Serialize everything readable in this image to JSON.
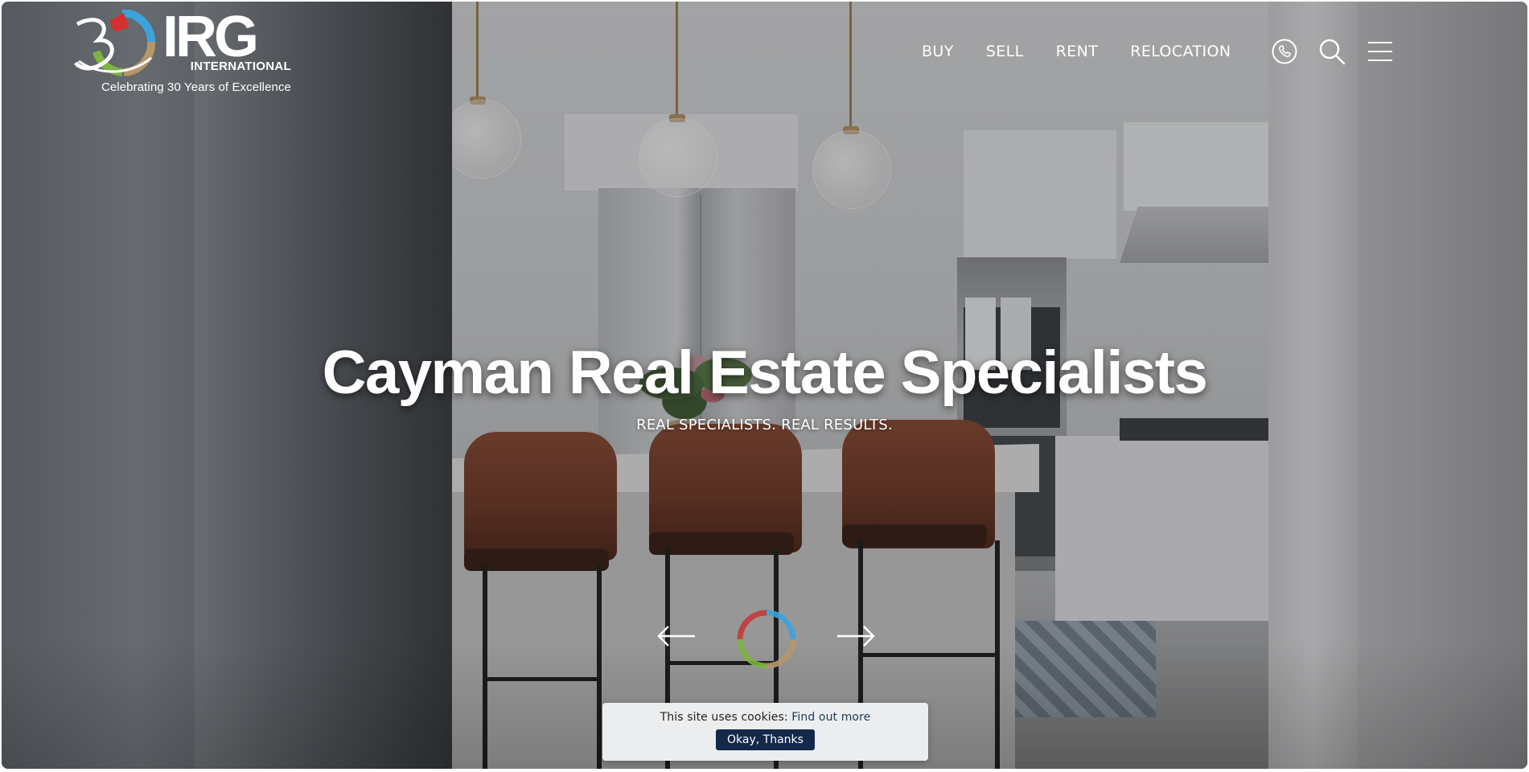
{
  "brand": {
    "logo_letters": "IRG",
    "logo_subtitle": "INTERNATIONAL",
    "tagline": "Celebrating 30 Years of Excellence",
    "colors": {
      "red": "#d32f2f",
      "blue": "#3aa3dc",
      "green": "#7cb342",
      "tan": "#b5976a"
    }
  },
  "nav": {
    "items": [
      "BUY",
      "SELL",
      "RENT",
      "RELOCATION"
    ]
  },
  "header_icons": [
    "phone-icon",
    "search-icon",
    "menu-icon"
  ],
  "hero": {
    "title": "Cayman Real Estate Specialists",
    "subtitle": "REAL SPECIALISTS. REAL RESULTS."
  },
  "slider": {
    "prev_icon": "arrow-left-icon",
    "next_icon": "arrow-right-icon",
    "loader_icon": "loading-ring-icon"
  },
  "cookie": {
    "text": "This site uses cookies:",
    "link": "Find out more",
    "button": "Okay, Thanks"
  }
}
